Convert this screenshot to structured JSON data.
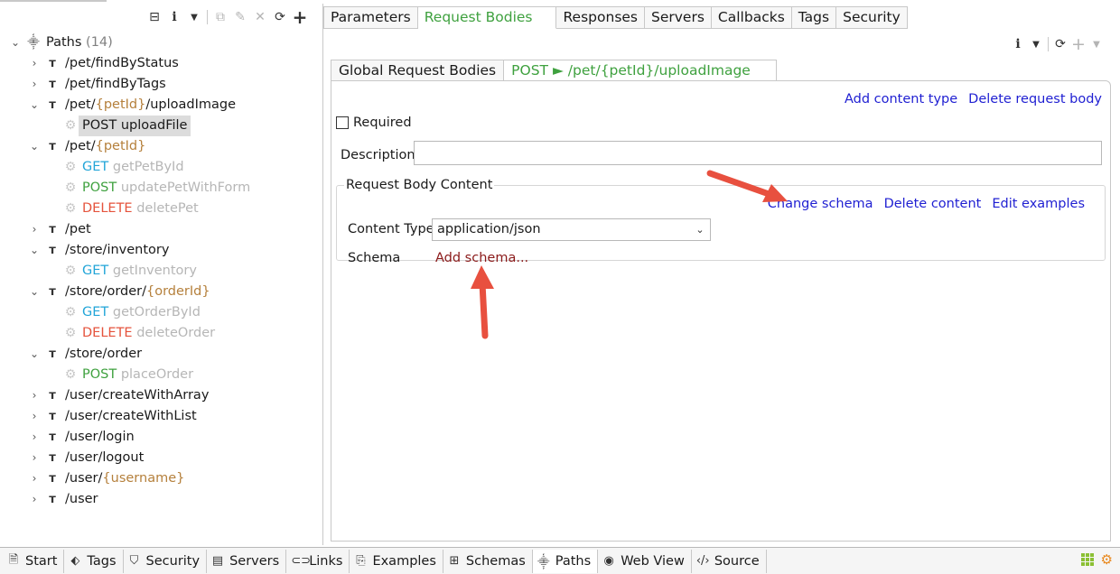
{
  "left_toolbar": {
    "icons": [
      "collapse-icon",
      "info-icon",
      "dropdown-icon",
      "copy-icon",
      "edit-icon",
      "delete-icon",
      "refresh-icon",
      "add-icon"
    ]
  },
  "tree": {
    "root_label": "Paths",
    "root_count": "(14)",
    "items": [
      {
        "kind": "path",
        "expanded": false,
        "parts": [
          "/pet/findByStatus"
        ]
      },
      {
        "kind": "path",
        "expanded": false,
        "parts": [
          "/pet/findByTags"
        ]
      },
      {
        "kind": "path",
        "expanded": true,
        "parts": [
          "/pet/",
          "{petId}",
          "/uploadImage"
        ]
      },
      {
        "kind": "op",
        "method": "POST",
        "name": "uploadFile",
        "selected": true
      },
      {
        "kind": "path",
        "expanded": true,
        "parts": [
          "/pet/",
          "{petId}"
        ]
      },
      {
        "kind": "op",
        "method": "GET",
        "name": "getPetById"
      },
      {
        "kind": "op",
        "method": "POST",
        "name": "updatePetWithForm"
      },
      {
        "kind": "op",
        "method": "DELETE",
        "name": "deletePet"
      },
      {
        "kind": "path",
        "expanded": false,
        "parts": [
          "/pet"
        ]
      },
      {
        "kind": "path",
        "expanded": true,
        "parts": [
          "/store/inventory"
        ]
      },
      {
        "kind": "op",
        "method": "GET",
        "name": "getInventory"
      },
      {
        "kind": "path",
        "expanded": true,
        "parts": [
          "/store/order/",
          "{orderId}"
        ]
      },
      {
        "kind": "op",
        "method": "GET",
        "name": "getOrderById"
      },
      {
        "kind": "op",
        "method": "DELETE",
        "name": "deleteOrder"
      },
      {
        "kind": "path",
        "expanded": true,
        "parts": [
          "/store/order"
        ]
      },
      {
        "kind": "op",
        "method": "POST",
        "name": "placeOrder"
      },
      {
        "kind": "path",
        "expanded": false,
        "parts": [
          "/user/createWithArray"
        ]
      },
      {
        "kind": "path",
        "expanded": false,
        "parts": [
          "/user/createWithList"
        ]
      },
      {
        "kind": "path",
        "expanded": false,
        "parts": [
          "/user/login"
        ]
      },
      {
        "kind": "path",
        "expanded": false,
        "parts": [
          "/user/logout"
        ]
      },
      {
        "kind": "path",
        "expanded": false,
        "parts": [
          "/user/",
          "{username}"
        ]
      },
      {
        "kind": "path",
        "expanded": false,
        "parts": [
          "/user"
        ]
      }
    ]
  },
  "editor": {
    "tabs": [
      "Parameters",
      "Request Bodies",
      "Responses",
      "Servers",
      "Callbacks",
      "Tags",
      "Security"
    ],
    "active_tab": "Request Bodies",
    "toolbar_icons": [
      "info-icon",
      "dropdown-icon",
      "refresh-icon",
      "add-icon",
      "dropdown-icon"
    ],
    "sub_tabs": {
      "global": "Global Request Bodies",
      "active_method": "POST",
      "active_arrow": "►",
      "active_path": "/pet/{petId}/uploadImage"
    },
    "links": {
      "add_content_type": "Add content type",
      "delete_request_body": "Delete request body"
    },
    "required_label": "Required",
    "required_checked": false,
    "description_label": "Description",
    "description_value": "",
    "content_group": {
      "title": "Request Body Content",
      "change_schema": "Change schema",
      "delete_content": "Delete content",
      "edit_examples": "Edit examples",
      "content_type_label": "Content Type",
      "content_type_value": "application/json",
      "schema_label": "Schema",
      "add_schema": "Add schema..."
    },
    "annotation_color": "#e8503f"
  },
  "bottom_tabs": [
    {
      "label": "Start",
      "icon": "document-icon"
    },
    {
      "label": "Tags",
      "icon": "tag-icon"
    },
    {
      "label": "Security",
      "icon": "shield-icon"
    },
    {
      "label": "Servers",
      "icon": "server-icon"
    },
    {
      "label": "Links",
      "icon": "link-icon"
    },
    {
      "label": "Examples",
      "icon": "examples-icon"
    },
    {
      "label": "Schemas",
      "icon": "schemas-icon"
    },
    {
      "label": "Paths",
      "icon": "paths-icon",
      "active": true
    },
    {
      "label": "Web View",
      "icon": "globe-icon"
    },
    {
      "label": "Source",
      "icon": "code-icon"
    }
  ],
  "status_icons": [
    "apps-grid-icon",
    "settings-gears-icon"
  ]
}
